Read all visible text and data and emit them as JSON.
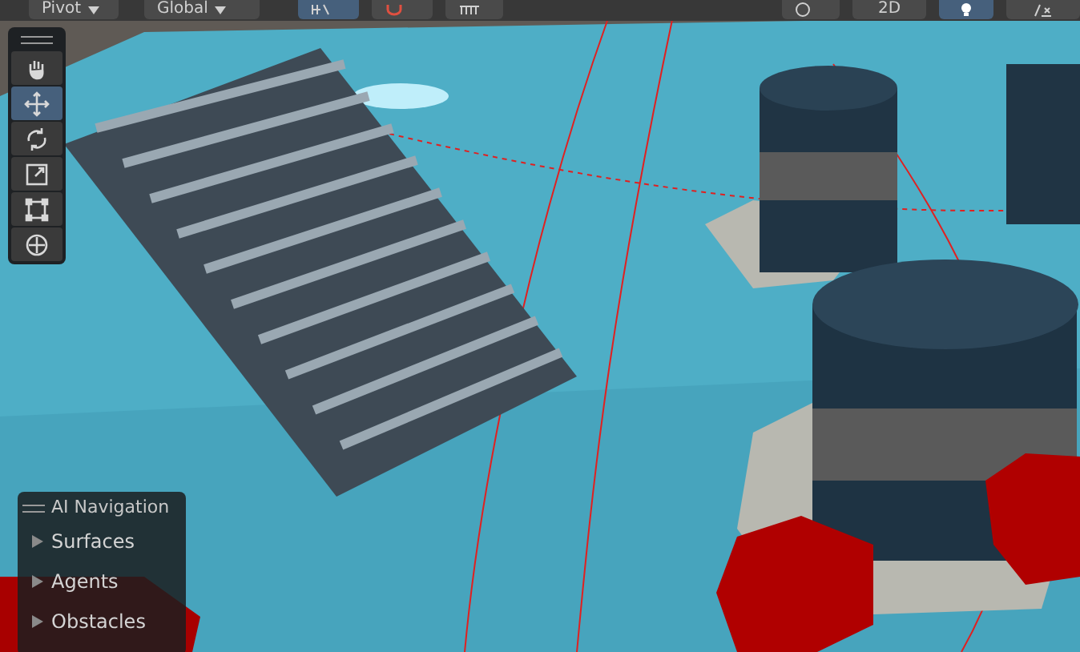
{
  "toolbar": {
    "pivot": {
      "label": "Pivot"
    },
    "global": {
      "label": "Global"
    },
    "snap": {
      "selected": true
    },
    "view_2d": {
      "label": "2D",
      "selected": false
    },
    "lighting": {
      "selected": true
    }
  },
  "tools": [
    {
      "kind": "hand",
      "selected": false
    },
    {
      "kind": "move",
      "selected": true
    },
    {
      "kind": "rotate",
      "selected": false
    },
    {
      "kind": "scale",
      "selected": false
    },
    {
      "kind": "rect",
      "selected": false
    },
    {
      "kind": "transform",
      "selected": false
    }
  ],
  "navigation_overlay": {
    "title": "AI Navigation",
    "items": [
      {
        "label": "Surfaces",
        "expanded": false
      },
      {
        "label": "Agents",
        "expanded": false
      },
      {
        "label": "Obstacles",
        "expanded": false
      }
    ]
  }
}
